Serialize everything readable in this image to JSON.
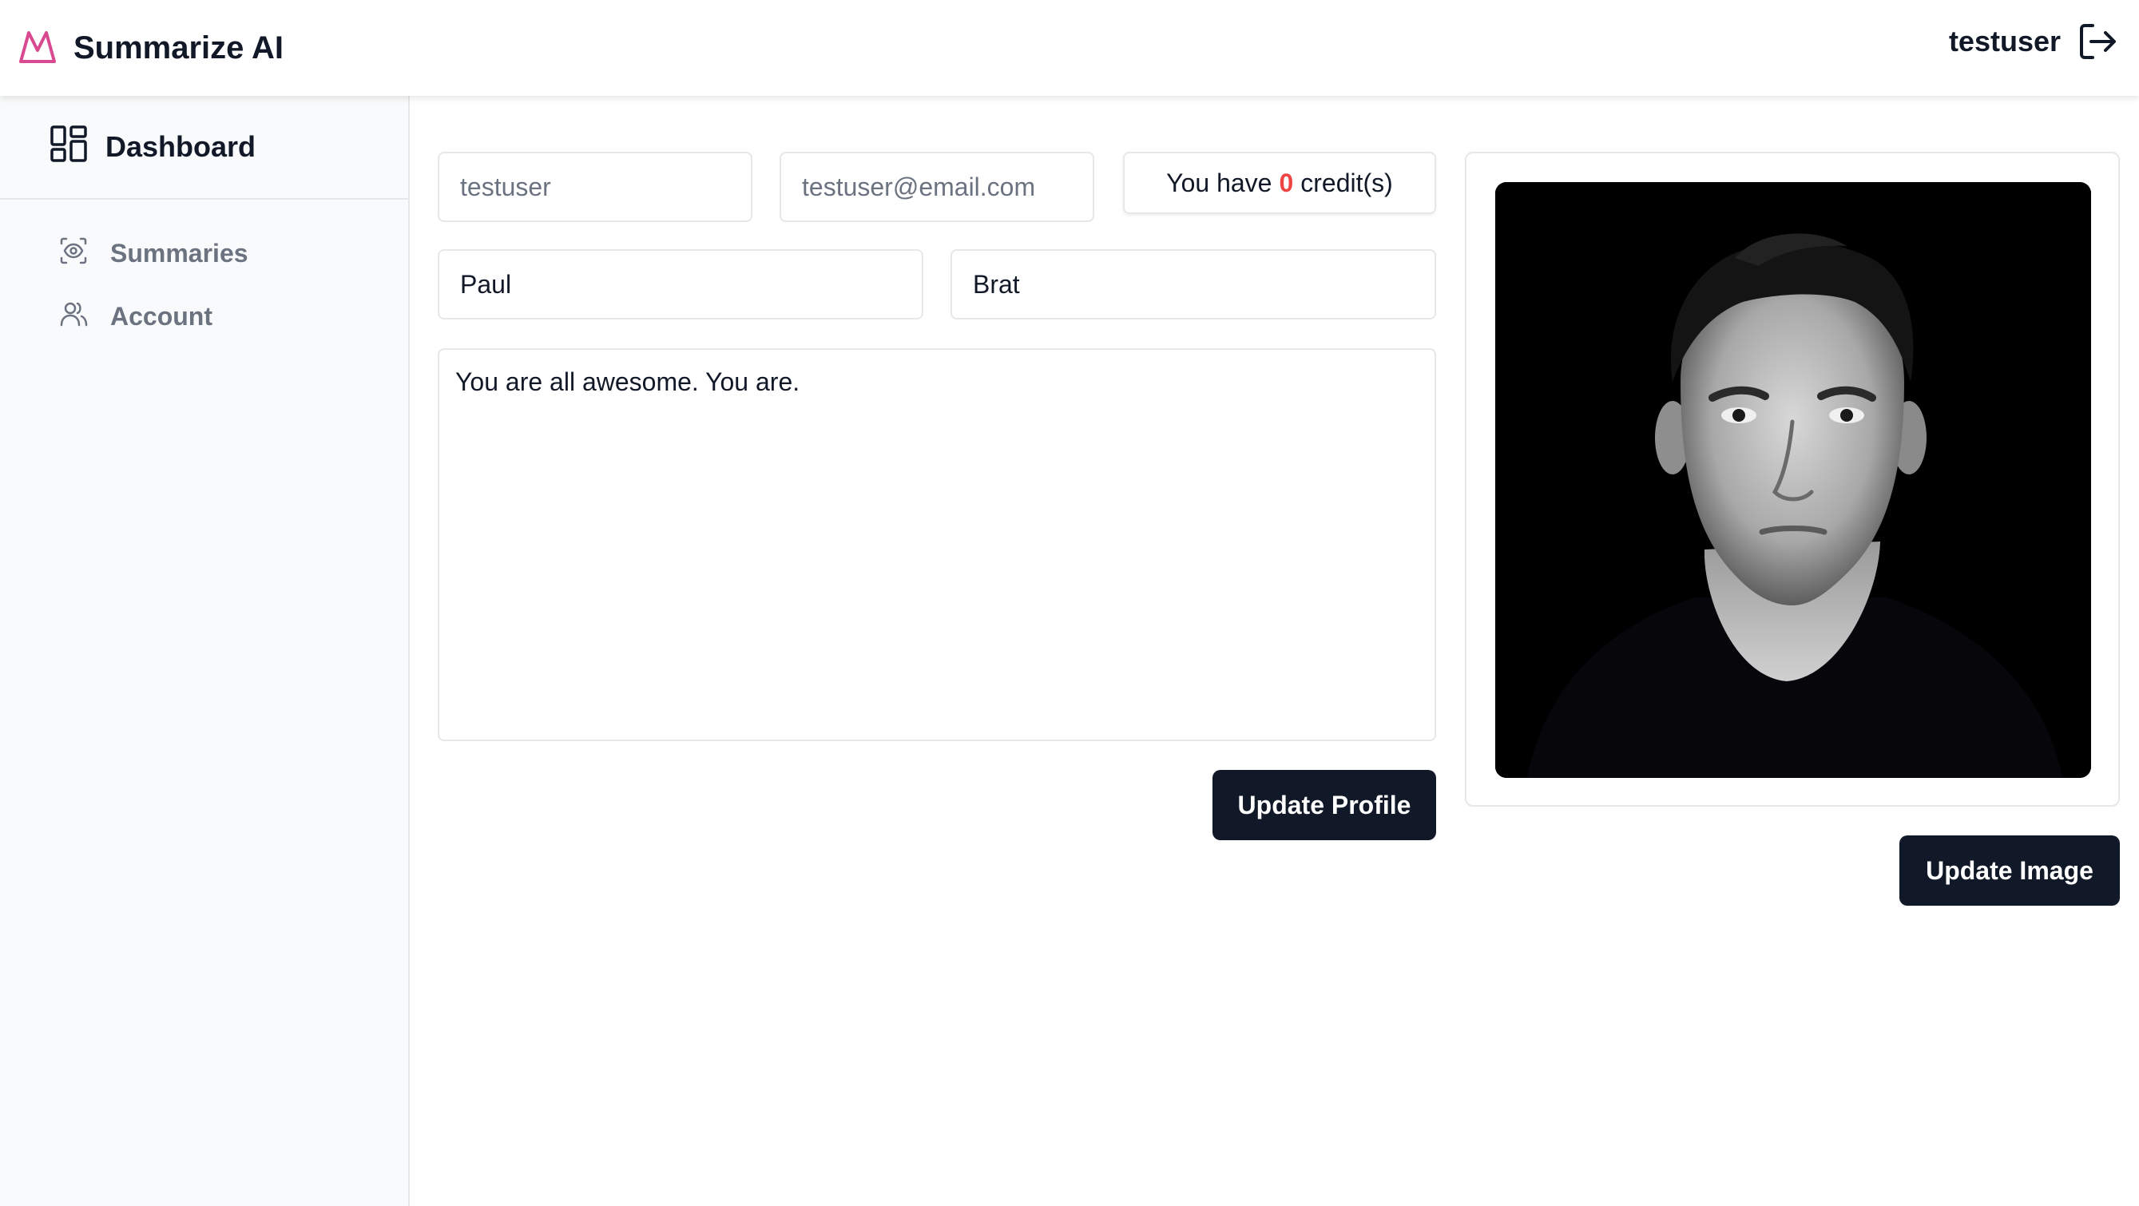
{
  "header": {
    "app_name": "Summarize AI",
    "username": "testuser",
    "brand_color": "#d9498f"
  },
  "sidebar": {
    "title": "Dashboard",
    "items": [
      {
        "label": "Summaries",
        "icon": "eye-scan-icon"
      },
      {
        "label": "Account",
        "icon": "users-icon"
      }
    ]
  },
  "profile": {
    "username": "testuser",
    "email": "testuser@email.com",
    "credits_prefix": "You have",
    "credits_count": "0",
    "credits_suffix": "credit(s)",
    "first_name": "Paul",
    "last_name": "Brat",
    "bio": "You are all awesome. You are.",
    "update_profile_label": "Update Profile"
  },
  "image": {
    "alt": "Profile portrait",
    "update_image_label": "Update Image"
  }
}
